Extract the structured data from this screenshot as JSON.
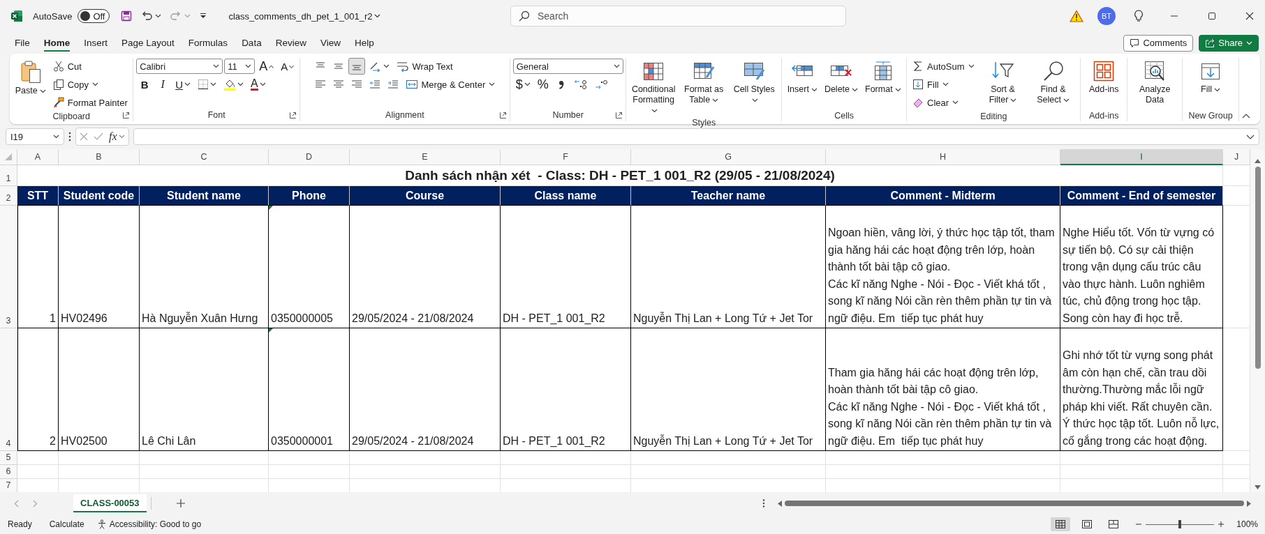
{
  "title_bar": {
    "autosave_label": "AutoSave",
    "autosave": {
      "on": false,
      "label": "Off"
    },
    "redo_disabled": true,
    "file_name": "class_comments_dh_pet_1_001_r2",
    "search": {
      "placeholder": "Search"
    },
    "avatar": "BT"
  },
  "menu_tabs": [
    {
      "label": "File",
      "selected": false
    },
    {
      "label": "Home",
      "selected": true
    },
    {
      "label": "Insert",
      "selected": false
    },
    {
      "label": "Page Layout",
      "selected": false
    },
    {
      "label": "Formulas",
      "selected": false
    },
    {
      "label": "Data",
      "selected": false
    },
    {
      "label": "Review",
      "selected": false
    },
    {
      "label": "View",
      "selected": false
    },
    {
      "label": "Help",
      "selected": false
    }
  ],
  "comments_button": "Comments",
  "share_button": "Share",
  "ribbon": {
    "groups": [
      {
        "label": "Clipboard",
        "launcher": true,
        "items": [
          {
            "kind": "large",
            "label": "Paste",
            "menu": true
          },
          {
            "kind": "stack",
            "rows": [
              {
                "items": [
                  {
                    "kind": "small",
                    "label": "Cut",
                    "menu": false
                  }
                ]
              },
              {
                "items": [
                  {
                    "kind": "small",
                    "label": "Copy",
                    "menu": true
                  }
                ]
              },
              {
                "items": [
                  {
                    "kind": "small",
                    "label": "Format Painter",
                    "menu": false
                  }
                ]
              }
            ]
          }
        ]
      },
      {
        "label": "Font",
        "launcher": true,
        "items": [
          {
            "kind": "stack",
            "rows": [
              {
                "items": [
                  {
                    "kind": "select",
                    "value": "Calibri"
                  },
                  {
                    "kind": "select",
                    "value": "11"
                  },
                  {
                    "kind": "tool",
                    "label": "A",
                    "menu": false
                  },
                  {
                    "kind": "tool",
                    "label": "A",
                    "menu": false
                  }
                ]
              },
              {
                "items": [
                  {
                    "kind": "tool",
                    "label": "B",
                    "menu": false,
                    "selected": false
                  },
                  {
                    "kind": "tool",
                    "label": "I",
                    "menu": false,
                    "selected": false
                  },
                  {
                    "kind": "tool",
                    "label": "U",
                    "menu": true,
                    "selected": false
                  },
                  {
                    "kind": "tool",
                    "menu": true
                  },
                  {
                    "kind": "tool",
                    "menu": true
                  },
                  {
                    "kind": "tool",
                    "label": "A",
                    "menu": true
                  }
                ]
              }
            ]
          }
        ]
      },
      {
        "label": "Alignment",
        "launcher": true,
        "items": [
          {
            "kind": "stack",
            "rows": [
              {
                "items": [
                  {
                    "kind": "tool",
                    "menu": false,
                    "selected": false
                  },
                  {
                    "kind": "tool",
                    "menu": false,
                    "selected": false
                  },
                  {
                    "kind": "tool",
                    "menu": false,
                    "selected": true
                  },
                  {
                    "kind": "tool",
                    "menu": true
                  },
                  {
                    "kind": "small",
                    "label": "Wrap Text",
                    "menu": false
                  }
                ]
              },
              {
                "items": [
                  {
                    "kind": "tool",
                    "menu": false,
                    "selected": false
                  },
                  {
                    "kind": "tool",
                    "menu": false,
                    "selected": false
                  },
                  {
                    "kind": "tool",
                    "menu": false,
                    "selected": false
                  },
                  {
                    "kind": "tool",
                    "menu": false
                  },
                  {
                    "kind": "tool",
                    "menu": false
                  },
                  {
                    "kind": "small",
                    "label": "Merge & Center",
                    "menu": true
                  }
                ]
              }
            ]
          }
        ]
      },
      {
        "label": "Number",
        "launcher": true,
        "items": [
          {
            "kind": "stack",
            "rows": [
              {
                "items": [
                  {
                    "kind": "select",
                    "value": "General"
                  }
                ]
              },
              {
                "items": [
                  {
                    "kind": "tool",
                    "label": "$",
                    "menu": true
                  },
                  {
                    "kind": "tool",
                    "label": "%",
                    "menu": false
                  },
                  {
                    "kind": "tool",
                    "menu": false
                  },
                  {
                    "kind": "tool",
                    "menu": false
                  },
                  {
                    "kind": "tool",
                    "menu": false
                  }
                ]
              }
            ]
          }
        ]
      },
      {
        "label": "Styles",
        "items": [
          {
            "kind": "large",
            "label": "Conditional Formatting",
            "menu": true
          },
          {
            "kind": "large",
            "label": "Format as Table",
            "menu": true
          },
          {
            "kind": "large",
            "label": "Cell Styles",
            "menu": true
          }
        ]
      },
      {
        "label": "Cells",
        "items": [
          {
            "kind": "large",
            "label": "Insert",
            "menu": true
          },
          {
            "kind": "large",
            "label": "Delete",
            "menu": true
          },
          {
            "kind": "large",
            "label": "Format",
            "menu": true
          }
        ]
      },
      {
        "label": "Editing",
        "items": [
          {
            "kind": "stack",
            "rows": [
              {
                "items": [
                  {
                    "kind": "small",
                    "label": "AutoSum",
                    "menu": true
                  }
                ]
              },
              {
                "items": [
                  {
                    "kind": "small",
                    "label": "Fill",
                    "menu": true
                  }
                ]
              },
              {
                "items": [
                  {
                    "kind": "small",
                    "label": "Clear",
                    "menu": true
                  }
                ]
              }
            ]
          },
          {
            "kind": "large",
            "label": "Sort & Filter",
            "menu": true
          },
          {
            "kind": "large",
            "label": "Find & Select",
            "menu": true
          }
        ]
      },
      {
        "label": "Add-ins",
        "items": [
          {
            "kind": "large",
            "label": "Add-ins",
            "menu": false
          }
        ]
      },
      {
        "items": [
          {
            "kind": "large",
            "label": "Analyze Data",
            "menu": false
          }
        ]
      },
      {
        "label": "New Group",
        "items": [
          {
            "kind": "large",
            "label": "Fill",
            "menu": true
          }
        ]
      }
    ]
  },
  "formula_bar": {
    "name_box": "I19",
    "function_label": "fx"
  },
  "sheet": {
    "columns": [
      {
        "label": "A",
        "selected": false
      },
      {
        "label": "B",
        "selected": false
      },
      {
        "label": "C",
        "selected": false
      },
      {
        "label": "D",
        "selected": false
      },
      {
        "label": "E",
        "selected": false
      },
      {
        "label": "F",
        "selected": false
      },
      {
        "label": "G",
        "selected": false
      },
      {
        "label": "H",
        "selected": false
      },
      {
        "label": "I",
        "selected": true
      },
      {
        "label": "J",
        "selected": false
      }
    ],
    "rows": [
      "1",
      "2",
      "3",
      "4",
      "5",
      "6",
      "7"
    ],
    "title": "Danh sách nhận xét  - Class: DH - PET_1 001_R2 (29/05 - 21/08/2024)",
    "header": [
      "STT",
      "Student code",
      "Student name",
      "Phone",
      "Course",
      "Class name",
      "Teacher name",
      "Comment - Midterm",
      "Comment - End of semester"
    ],
    "records": [
      {
        "phone_warning": true,
        "cells": [
          "1",
          "HV02496",
          "Hà Nguyễn Xuân Hưng",
          "0350000005",
          "29/05/2024 - 21/08/2024",
          "DH - PET_1 001_R2",
          "Nguyễn Thị Lan + Long Tứ + Jet Tor",
          "Ngoan hiền, vâng lời, ý thức học tập tốt, tham gia hăng hái các hoạt động trên lớp, hoàn thành tốt bài tập cô giao.\nCác kĩ năng Nghe - Nói - Đọc - Viết khá tốt , song kĩ năng Nói cần rèn thêm phần tự tin và ngữ điệu. Em  tiếp tục phát huy",
          "Nghe Hiểu tốt. Vốn từ vựng có sự tiến bộ. Có sự cải thiện trong vận dụng cấu trúc câu vào thực hành. Luôn nghiêm túc, chủ động trong học tập. Song còn hay đi học trễ."
        ]
      },
      {
        "phone_warning": true,
        "cells": [
          "2",
          "HV02500",
          "Lê Chi Lân",
          "0350000001",
          "29/05/2024 - 21/08/2024",
          "DH - PET_1 001_R2",
          "Nguyễn Thị Lan + Long Tứ + Jet Tor",
          "Tham gia hăng hái các hoạt động trên lớp, hoàn thành tốt bài tập cô giao.\nCác kĩ năng Nghe - Nói - Đọc - Viết khá tốt , song kĩ năng Nói cần rèn thêm phần tự tin và ngữ điệu. Em  tiếp tục phát huy",
          "Ghi nhớ tốt từ vựng song phát âm còn hạn chế, cần trau dồi thường.Thường mắc lỗi ngữ pháp khi viết. Rất chuyên cần. Ý thức học tập tốt. Luôn nỗ lực, cố gắng trong các hoạt động."
        ]
      }
    ]
  },
  "sheet_tabs": [
    {
      "label": "CLASS-00053",
      "selected": true
    }
  ],
  "status_bar": {
    "mode": "Ready",
    "calculate": "Calculate",
    "accessibility": "Accessibility: Good to go",
    "views": [
      {
        "kind": "normal",
        "selected": true
      },
      {
        "kind": "page_layout",
        "selected": false
      },
      {
        "kind": "page_break",
        "selected": false
      }
    ],
    "zoom": {
      "level": 0.5,
      "label": "100%"
    }
  }
}
